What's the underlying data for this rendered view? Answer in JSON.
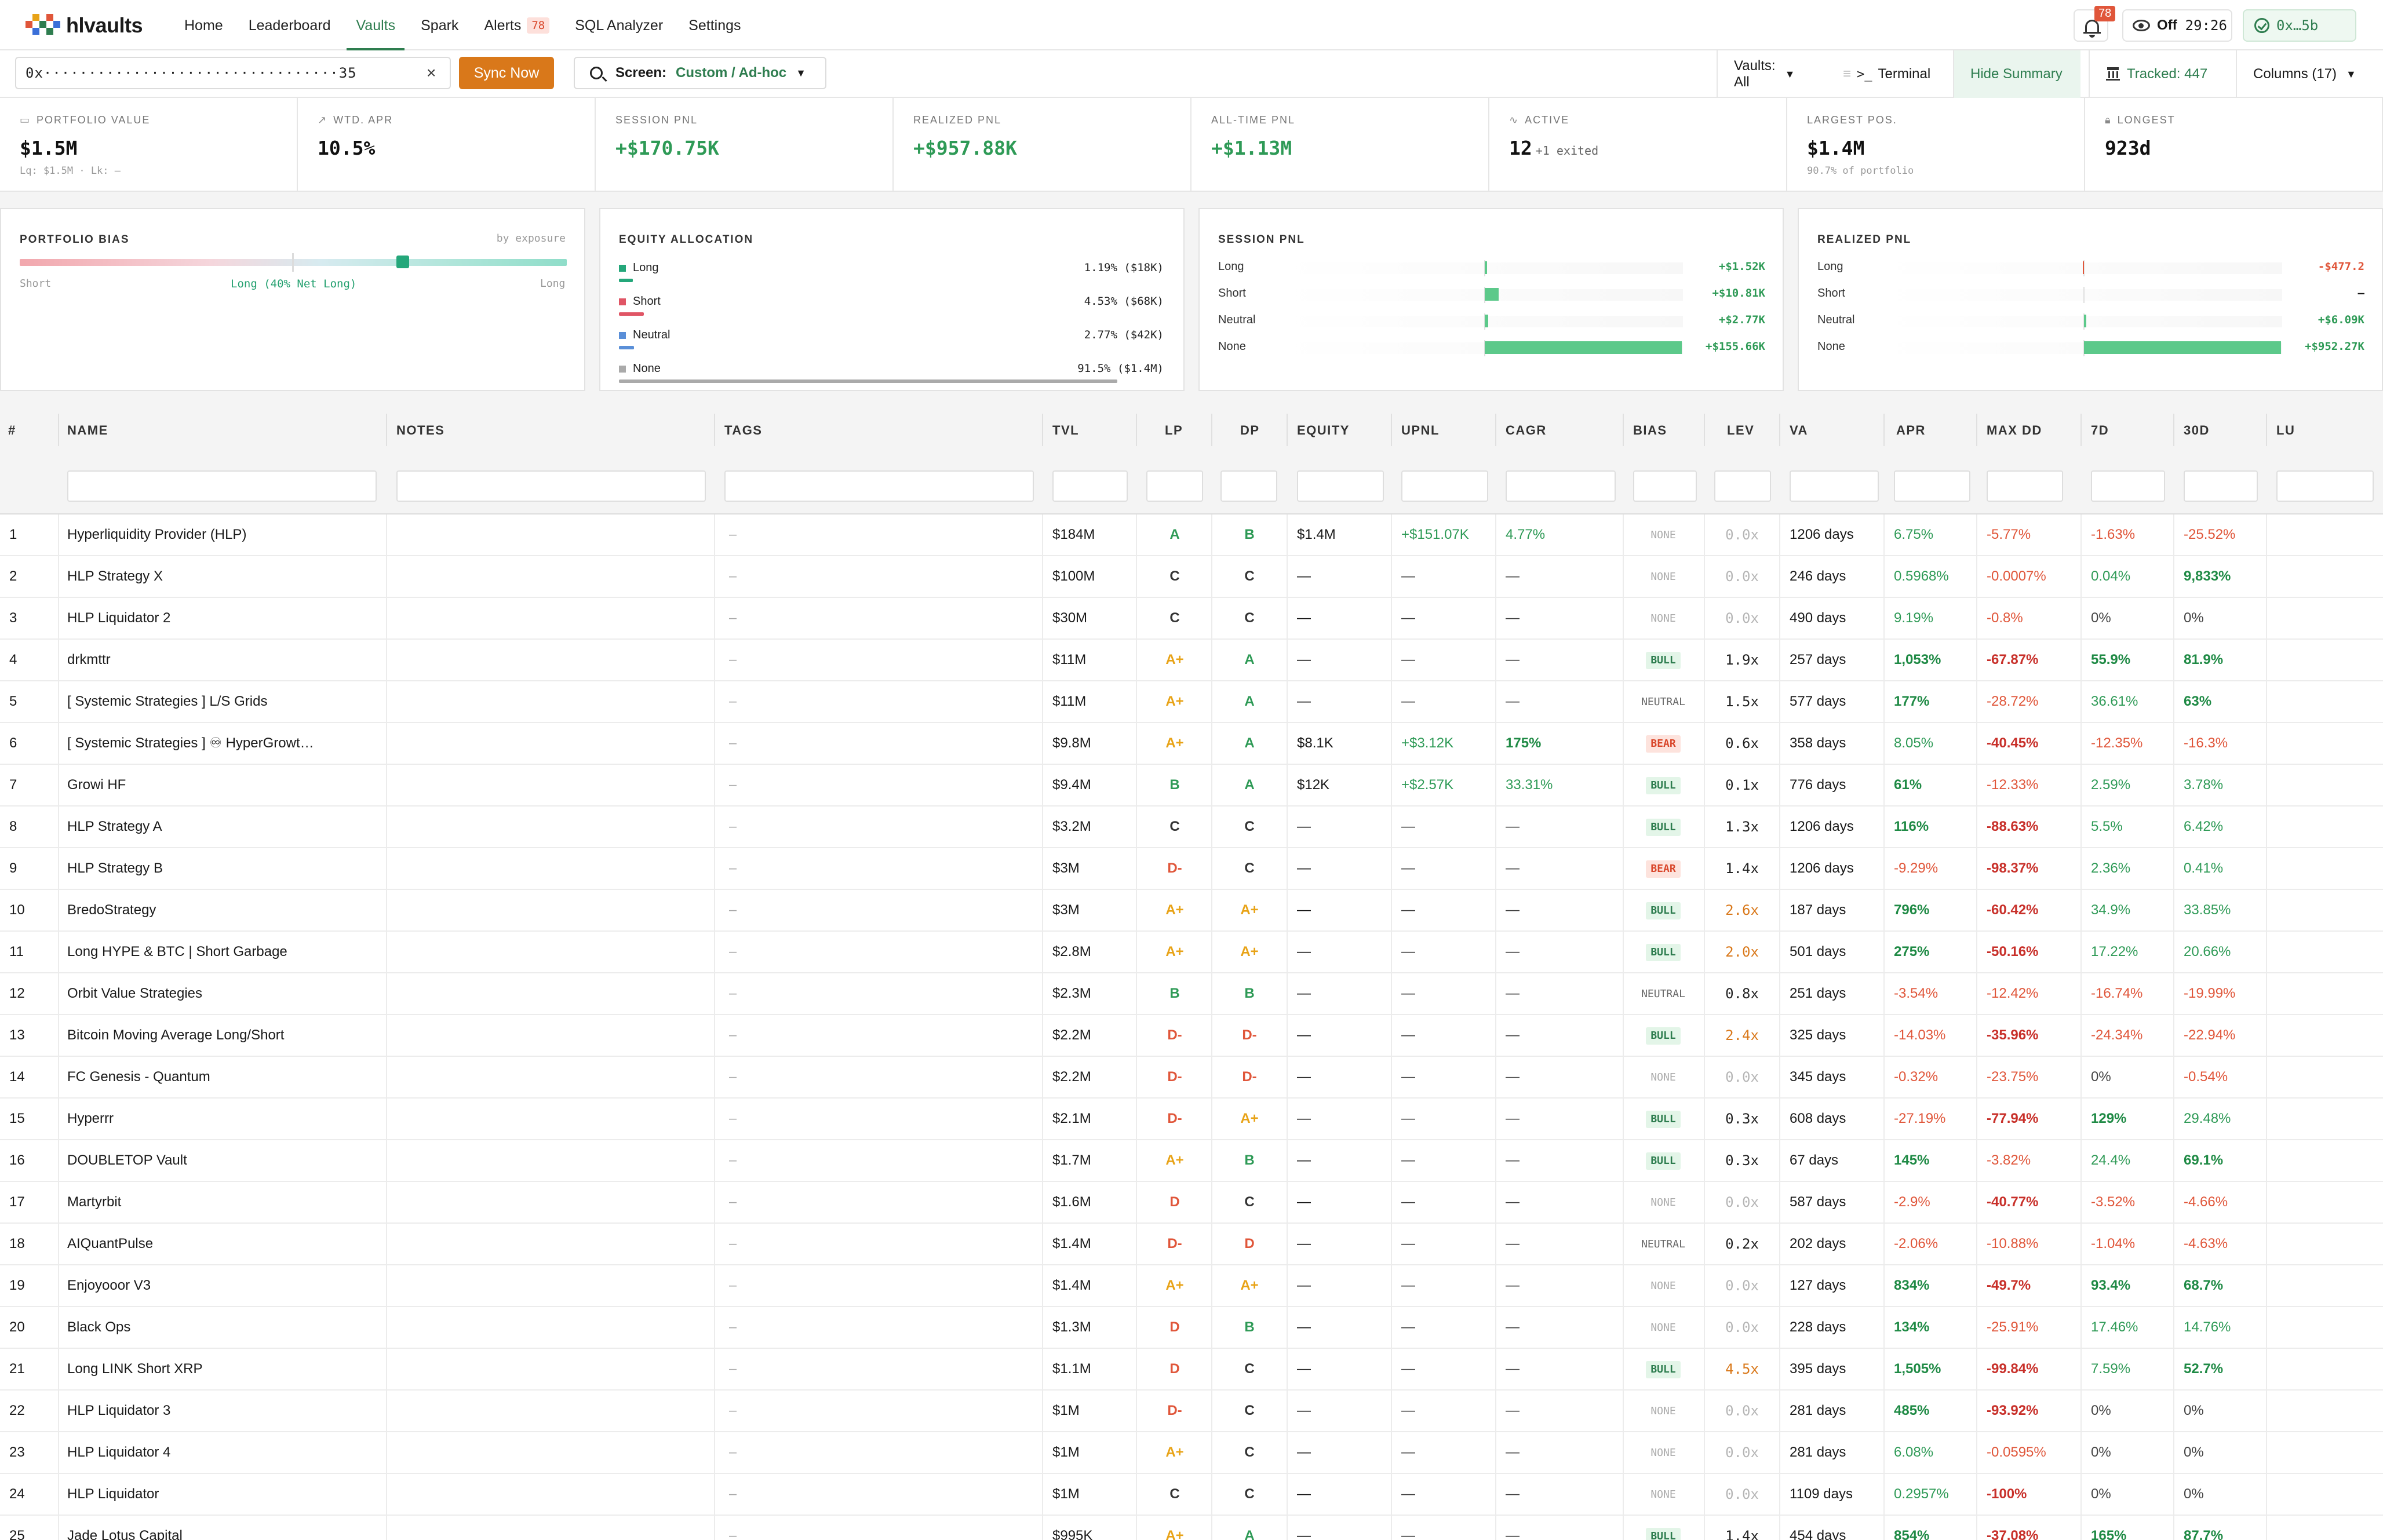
{
  "app": {
    "brand": "hlvaults",
    "brand_colors": [
      "#e0563a",
      "#2e7d4f",
      "#3a6fd8",
      "#e8a317"
    ]
  },
  "nav": {
    "items": [
      {
        "label": "Home",
        "active": false
      },
      {
        "label": "Leaderboard",
        "active": false
      },
      {
        "label": "Vaults",
        "active": true
      },
      {
        "label": "Spark",
        "active": false
      },
      {
        "label": "Alerts",
        "active": false,
        "badge": "78"
      },
      {
        "label": "SQL Analyzer",
        "active": false
      },
      {
        "label": "Settings",
        "active": false
      }
    ],
    "notifications_count": "78",
    "watch_label": "Off",
    "watch_timer": "29:26",
    "wallet": "0x…5b"
  },
  "toolbar": {
    "address_value": "0x·································35",
    "clear_label": "×",
    "sync_label": "Sync Now",
    "screen_label": "Screen:",
    "screen_value": "Custom / Ad-hoc",
    "vaults_filter": "Vaults: All",
    "terminal_label": "Terminal",
    "terminal_icon": ">_",
    "hide_summary_label": "Hide Summary",
    "tracked_label": "Tracked: 447",
    "columns_label": "Columns (17)"
  },
  "stats": [
    {
      "label": "PORTFOLIO VALUE",
      "icon": "wallet-icon",
      "value": "$1.5M",
      "sub": "Lq: $1.5M · Lk: —"
    },
    {
      "label": "WTD. APR",
      "icon": "trend-icon",
      "value": "10.5%",
      "sub": ""
    },
    {
      "label": "SESSION PNL",
      "icon": "",
      "value": "+$170.75K",
      "sub": ""
    },
    {
      "label": "REALIZED PNL",
      "icon": "",
      "value": "+$957.88K",
      "sub": ""
    },
    {
      "label": "ALL-TIME PNL",
      "icon": "",
      "value": "+$1.13M",
      "sub": ""
    },
    {
      "label": "ACTIVE",
      "icon": "pulse-icon",
      "value": "12",
      "value_suffix": "+1 exited",
      "sub": ""
    },
    {
      "label": "LARGEST POS.",
      "icon": "",
      "value": "$1.4M",
      "sub": "90.7% of portfolio"
    },
    {
      "label": "LONGEST",
      "icon": "lock-icon",
      "value": "923d",
      "sub": ""
    }
  ],
  "bias_card": {
    "title": "PORTFOLIO BIAS",
    "note": "by exposure",
    "left": "Short",
    "right": "Long",
    "center": "Long (40% Net Long)",
    "net_long_pct": 40
  },
  "equity_card": {
    "title": "EQUITY ALLOCATION",
    "rows": [
      {
        "name": "Long",
        "value": "1.19% ($18K)",
        "pct": 1.19,
        "color": "#24a77a"
      },
      {
        "name": "Short",
        "value": "4.53% ($68K)",
        "pct": 4.53,
        "color": "#e05565"
      },
      {
        "name": "Neutral",
        "value": "2.77% ($42K)",
        "pct": 2.77,
        "color": "#5a8fd8"
      },
      {
        "name": "None",
        "value": "91.5% ($1.4M)",
        "pct": 91.5,
        "color": "#aaaaaa"
      }
    ]
  },
  "session_card": {
    "title": "SESSION PNL",
    "rows": [
      {
        "name": "Long",
        "value": "+$1.52K",
        "amount": 1.52
      },
      {
        "name": "Short",
        "value": "+$10.81K",
        "amount": 10.81
      },
      {
        "name": "Neutral",
        "value": "+$2.77K",
        "amount": 2.77
      },
      {
        "name": "None",
        "value": "+$155.66K",
        "amount": 155.66
      }
    ]
  },
  "realized_card": {
    "title": "REALIZED PNL",
    "rows": [
      {
        "name": "Long",
        "value": "-$477.2",
        "amount": -0.4772
      },
      {
        "name": "Short",
        "value": "–",
        "amount": 0
      },
      {
        "name": "Neutral",
        "value": "+$6.09K",
        "amount": 6.09
      },
      {
        "name": "None",
        "value": "+$952.27K",
        "amount": 952.27
      }
    ]
  },
  "table": {
    "headers": [
      "#",
      "NAME",
      "NOTES",
      "TAGS",
      "TVL",
      "LP",
      "DP",
      "EQUITY",
      "UPNL",
      "CAGR",
      "BIAS",
      "LEV",
      "VA",
      "APR",
      "MAX DD",
      "7D",
      "30D",
      "LU"
    ],
    "rows": [
      {
        "n": "1",
        "name": "Hyperliquidity Provider (HLP)",
        "tags": "–",
        "tvl": "$184M",
        "lp": "A",
        "dp": "B",
        "equity": "$1.4M",
        "upnl": "+$151.07K",
        "cagr": "4.77%",
        "bias": "NONE",
        "lev": "0.0x",
        "va": "1206 days",
        "apr": "6.75%",
        "dd": "-5.77%",
        "d7": "-1.63%",
        "d30": "-25.52%"
      },
      {
        "n": "2",
        "name": "HLP Strategy X",
        "tags": "–",
        "tvl": "$100M",
        "lp": "C",
        "dp": "C",
        "equity": "—",
        "upnl": "—",
        "cagr": "—",
        "bias": "NONE",
        "lev": "0.0x",
        "va": "246 days",
        "apr": "0.5968%",
        "dd": "-0.0007%",
        "d7": "0.04%",
        "d30": "9,833%"
      },
      {
        "n": "3",
        "name": "HLP Liquidator 2",
        "tags": "–",
        "tvl": "$30M",
        "lp": "C",
        "dp": "C",
        "equity": "—",
        "upnl": "—",
        "cagr": "—",
        "bias": "NONE",
        "lev": "0.0x",
        "va": "490 days",
        "apr": "9.19%",
        "dd": "-0.8%",
        "d7": "0%",
        "d30": "0%"
      },
      {
        "n": "4",
        "name": "drkmttr",
        "tags": "–",
        "tvl": "$11M",
        "lp": "A+",
        "dp": "A",
        "equity": "—",
        "upnl": "—",
        "cagr": "—",
        "bias": "BULL",
        "lev": "1.9x",
        "va": "257 days",
        "apr": "1,053%",
        "dd": "-67.87%",
        "d7": "55.9%",
        "d30": "81.9%"
      },
      {
        "n": "5",
        "name": "[ Systemic Strategies ] L/S Grids",
        "tags": "–",
        "tvl": "$11M",
        "lp": "A+",
        "dp": "A",
        "equity": "—",
        "upnl": "—",
        "cagr": "—",
        "bias": "NEUTRAL",
        "lev": "1.5x",
        "va": "577 days",
        "apr": "177%",
        "dd": "-28.72%",
        "d7": "36.61%",
        "d30": "63%"
      },
      {
        "n": "6",
        "name": "[ Systemic Strategies ] ♾ HyperGrowt…",
        "tags": "–",
        "tvl": "$9.8M",
        "lp": "A+",
        "dp": "A",
        "equity": "$8.1K",
        "upnl": "+$3.12K",
        "cagr": "175%",
        "bias": "BEAR",
        "lev": "0.6x",
        "va": "358 days",
        "apr": "8.05%",
        "dd": "-40.45%",
        "d7": "-12.35%",
        "d30": "-16.3%"
      },
      {
        "n": "7",
        "name": "Growi HF",
        "tags": "–",
        "tvl": "$9.4M",
        "lp": "B",
        "dp": "A",
        "equity": "$12K",
        "upnl": "+$2.57K",
        "cagr": "33.31%",
        "bias": "BULL",
        "lev": "0.1x",
        "va": "776 days",
        "apr": "61%",
        "dd": "-12.33%",
        "d7": "2.59%",
        "d30": "3.78%"
      },
      {
        "n": "8",
        "name": "HLP Strategy A",
        "tags": "–",
        "tvl": "$3.2M",
        "lp": "C",
        "dp": "C",
        "equity": "—",
        "upnl": "—",
        "cagr": "—",
        "bias": "BULL",
        "lev": "1.3x",
        "va": "1206 days",
        "apr": "116%",
        "dd": "-88.63%",
        "d7": "5.5%",
        "d30": "6.42%"
      },
      {
        "n": "9",
        "name": "HLP Strategy B",
        "tags": "–",
        "tvl": "$3M",
        "lp": "D-",
        "dp": "C",
        "equity": "—",
        "upnl": "—",
        "cagr": "—",
        "bias": "BEAR",
        "lev": "1.4x",
        "va": "1206 days",
        "apr": "-9.29%",
        "dd": "-98.37%",
        "d7": "2.36%",
        "d30": "0.41%"
      },
      {
        "n": "10",
        "name": "BredoStrategy",
        "tags": "–",
        "tvl": "$3M",
        "lp": "A+",
        "dp": "A+",
        "equity": "—",
        "upnl": "—",
        "cagr": "—",
        "bias": "BULL",
        "lev": "2.6x",
        "va": "187 days",
        "apr": "796%",
        "dd": "-60.42%",
        "d7": "34.9%",
        "d30": "33.85%"
      },
      {
        "n": "11",
        "name": "Long HYPE & BTC | Short Garbage",
        "tags": "–",
        "tvl": "$2.8M",
        "lp": "A+",
        "dp": "A+",
        "equity": "—",
        "upnl": "—",
        "cagr": "—",
        "bias": "BULL",
        "lev": "2.0x",
        "va": "501 days",
        "apr": "275%",
        "dd": "-50.16%",
        "d7": "17.22%",
        "d30": "20.66%"
      },
      {
        "n": "12",
        "name": "Orbit Value Strategies",
        "tags": "–",
        "tvl": "$2.3M",
        "lp": "B",
        "dp": "B",
        "equity": "—",
        "upnl": "—",
        "cagr": "—",
        "bias": "NEUTRAL",
        "lev": "0.8x",
        "va": "251 days",
        "apr": "-3.54%",
        "dd": "-12.42%",
        "d7": "-16.74%",
        "d30": "-19.99%"
      },
      {
        "n": "13",
        "name": "Bitcoin Moving Average Long/Short",
        "tags": "–",
        "tvl": "$2.2M",
        "lp": "D-",
        "dp": "D-",
        "equity": "—",
        "upnl": "—",
        "cagr": "—",
        "bias": "BULL",
        "lev": "2.4x",
        "va": "325 days",
        "apr": "-14.03%",
        "dd": "-35.96%",
        "d7": "-24.34%",
        "d30": "-22.94%"
      },
      {
        "n": "14",
        "name": "FC Genesis - Quantum",
        "tags": "–",
        "tvl": "$2.2M",
        "lp": "D-",
        "dp": "D-",
        "equity": "—",
        "upnl": "—",
        "cagr": "—",
        "bias": "NONE",
        "lev": "0.0x",
        "va": "345 days",
        "apr": "-0.32%",
        "dd": "-23.75%",
        "d7": "0%",
        "d30": "-0.54%"
      },
      {
        "n": "15",
        "name": "Hyperrr",
        "tags": "–",
        "tvl": "$2.1M",
        "lp": "D-",
        "dp": "A+",
        "equity": "—",
        "upnl": "—",
        "cagr": "—",
        "bias": "BULL",
        "lev": "0.3x",
        "va": "608 days",
        "apr": "-27.19%",
        "dd": "-77.94%",
        "d7": "129%",
        "d30": "29.48%"
      },
      {
        "n": "16",
        "name": "DOUBLETOP Vault",
        "tags": "–",
        "tvl": "$1.7M",
        "lp": "A+",
        "dp": "B",
        "equity": "—",
        "upnl": "—",
        "cagr": "—",
        "bias": "BULL",
        "lev": "0.3x",
        "va": "67 days",
        "apr": "145%",
        "dd": "-3.82%",
        "d7": "24.4%",
        "d30": "69.1%"
      },
      {
        "n": "17",
        "name": "Martyrbit",
        "tags": "–",
        "tvl": "$1.6M",
        "lp": "D",
        "dp": "C",
        "equity": "—",
        "upnl": "—",
        "cagr": "—",
        "bias": "NONE",
        "lev": "0.0x",
        "va": "587 days",
        "apr": "-2.9%",
        "dd": "-40.77%",
        "d7": "-3.52%",
        "d30": "-4.66%"
      },
      {
        "n": "18",
        "name": "AIQuantPulse",
        "tags": "–",
        "tvl": "$1.4M",
        "lp": "D-",
        "dp": "D",
        "equity": "—",
        "upnl": "—",
        "cagr": "—",
        "bias": "NEUTRAL",
        "lev": "0.2x",
        "va": "202 days",
        "apr": "-2.06%",
        "dd": "-10.88%",
        "d7": "-1.04%",
        "d30": "-4.63%"
      },
      {
        "n": "19",
        "name": "Enjoyooor V3",
        "tags": "–",
        "tvl": "$1.4M",
        "lp": "A+",
        "dp": "A+",
        "equity": "—",
        "upnl": "—",
        "cagr": "—",
        "bias": "NONE",
        "lev": "0.0x",
        "va": "127 days",
        "apr": "834%",
        "dd": "-49.7%",
        "d7": "93.4%",
        "d30": "68.7%"
      },
      {
        "n": "20",
        "name": "Black Ops",
        "tags": "–",
        "tvl": "$1.3M",
        "lp": "D",
        "dp": "B",
        "equity": "—",
        "upnl": "—",
        "cagr": "—",
        "bias": "NONE",
        "lev": "0.0x",
        "va": "228 days",
        "apr": "134%",
        "dd": "-25.91%",
        "d7": "17.46%",
        "d30": "14.76%"
      },
      {
        "n": "21",
        "name": "Long LINK Short XRP",
        "tags": "–",
        "tvl": "$1.1M",
        "lp": "D",
        "dp": "C",
        "equity": "—",
        "upnl": "—",
        "cagr": "—",
        "bias": "BULL",
        "lev": "4.5x",
        "va": "395 days",
        "apr": "1,505%",
        "dd": "-99.84%",
        "d7": "7.59%",
        "d30": "52.7%"
      },
      {
        "n": "22",
        "name": "HLP Liquidator 3",
        "tags": "–",
        "tvl": "$1M",
        "lp": "D-",
        "dp": "C",
        "equity": "—",
        "upnl": "—",
        "cagr": "—",
        "bias": "NONE",
        "lev": "0.0x",
        "va": "281 days",
        "apr": "485%",
        "dd": "-93.92%",
        "d7": "0%",
        "d30": "0%"
      },
      {
        "n": "23",
        "name": "HLP Liquidator 4",
        "tags": "–",
        "tvl": "$1M",
        "lp": "A+",
        "dp": "C",
        "equity": "—",
        "upnl": "—",
        "cagr": "—",
        "bias": "NONE",
        "lev": "0.0x",
        "va": "281 days",
        "apr": "6.08%",
        "dd": "-0.0595%",
        "d7": "0%",
        "d30": "0%"
      },
      {
        "n": "24",
        "name": "HLP Liquidator",
        "tags": "–",
        "tvl": "$1M",
        "lp": "C",
        "dp": "C",
        "equity": "—",
        "upnl": "—",
        "cagr": "—",
        "bias": "NONE",
        "lev": "0.0x",
        "va": "1109 days",
        "apr": "0.2957%",
        "dd": "-100%",
        "d7": "0%",
        "d30": "0%"
      },
      {
        "n": "25",
        "name": "Jade Lotus Capital",
        "tags": "–",
        "tvl": "$995K",
        "lp": "A+",
        "dp": "A",
        "equity": "—",
        "upnl": "—",
        "cagr": "—",
        "bias": "BULL",
        "lev": "1.4x",
        "va": "454 days",
        "apr": "854%",
        "dd": "-37.08%",
        "d7": "165%",
        "d30": "87.7%"
      }
    ]
  }
}
